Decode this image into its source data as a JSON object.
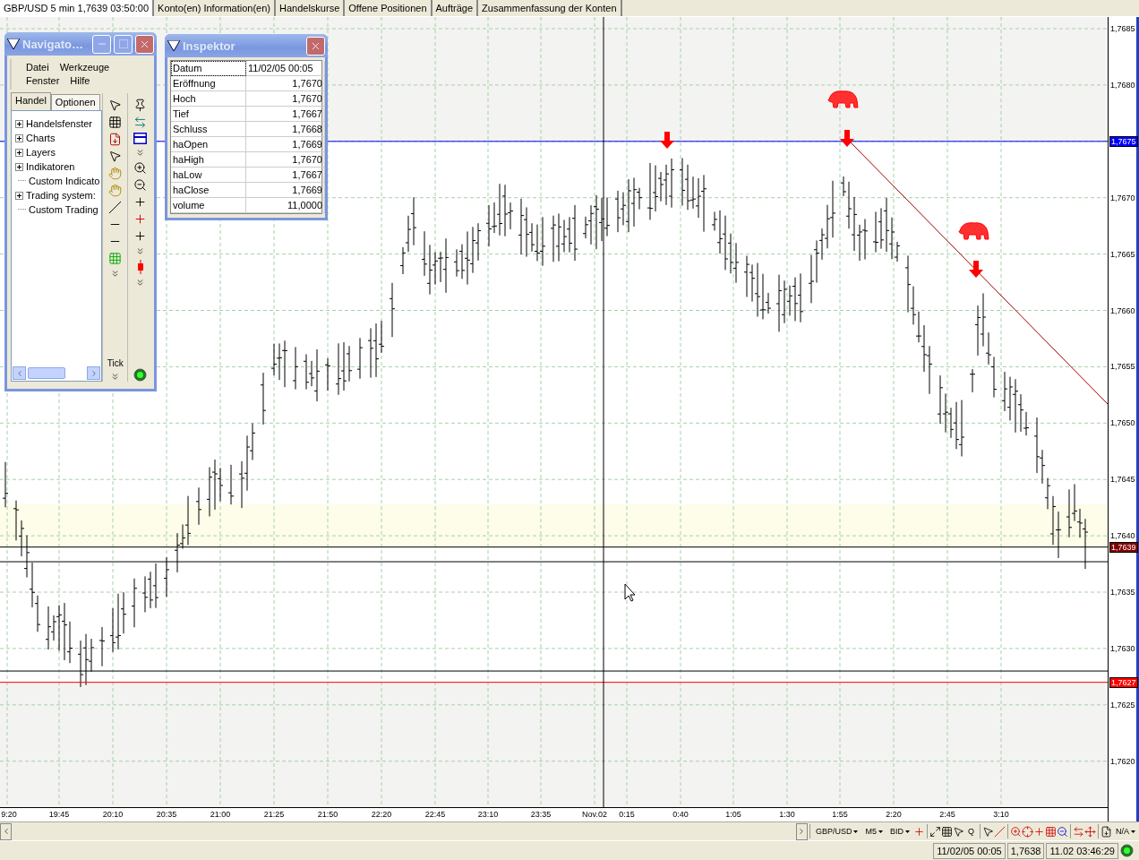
{
  "tabs": [
    {
      "label": "GBP/USD 5 min 1,7639 03:50:00",
      "selected": true
    },
    {
      "label": "Konto(en) Information(en)",
      "selected": false
    },
    {
      "label": "Handelskurse",
      "selected": false
    },
    {
      "label": "Offene Positionen",
      "selected": false
    },
    {
      "label": "Aufträge",
      "selected": false
    },
    {
      "label": "Zusammenfassung der Konten",
      "selected": false
    }
  ],
  "chart": {
    "y_axis_labels": [
      "1,7685",
      "1,7680",
      "1,7670",
      "1,7665",
      "1,7660",
      "1,7655",
      "1,7650",
      "1,7645",
      "1,7640",
      "1,7635",
      "1,7630",
      "1,7625",
      "1,7620"
    ],
    "price_markers": [
      {
        "label": "1,7675",
        "color": "#0000ff"
      },
      {
        "label": "1,7639",
        "color": "#800000"
      },
      {
        "label": "1,7627",
        "color": "#ff0000"
      }
    ],
    "x_axis_labels": [
      "9:20",
      "19:45",
      "20:10",
      "20:35",
      "21:00",
      "21:25",
      "21:50",
      "22:20",
      "22:45",
      "23:10",
      "23:35",
      "Nov.02",
      "0:15",
      "0:40",
      "1:05",
      "1:30",
      "1:55",
      "2:20",
      "2:45",
      "3:10"
    ]
  },
  "navigator": {
    "title": "Navigato…",
    "menu": [
      "Datei",
      "Werkzeuge",
      "Fenster",
      "Hilfe"
    ],
    "tabs": [
      {
        "label": "Handel",
        "selected": true
      },
      {
        "label": "Optionen",
        "selected": false
      }
    ],
    "tree": [
      {
        "label": "Handelsfenster",
        "expandable": true
      },
      {
        "label": "Charts",
        "expandable": true
      },
      {
        "label": "Layers",
        "expandable": true
      },
      {
        "label": "Indikatoren",
        "expandable": true
      },
      {
        "label": "Custom Indicato",
        "expandable": false
      },
      {
        "label": "Trading system:",
        "expandable": true
      },
      {
        "label": "Custom Trading",
        "expandable": false
      }
    ],
    "tool_label": "Tick"
  },
  "inspector": {
    "title": "Inspektor",
    "rows": [
      {
        "label": "Datum",
        "value": "11/02/05 00:05",
        "selected": true
      },
      {
        "label": "Eröffnung",
        "value": "1,7670",
        "selected": false
      },
      {
        "label": "Hoch",
        "value": "1,7670",
        "selected": false
      },
      {
        "label": "Tief",
        "value": "1,7667",
        "selected": false
      },
      {
        "label": "Schluss",
        "value": "1,7668",
        "selected": false
      },
      {
        "label": "haOpen",
        "value": "1,7669",
        "selected": false
      },
      {
        "label": "haHigh",
        "value": "1,7670",
        "selected": false
      },
      {
        "label": "haLow",
        "value": "1,7667",
        "selected": false
      },
      {
        "label": "haClose",
        "value": "1,7669",
        "selected": false
      },
      {
        "label": "volume",
        "value": "11,0000",
        "selected": false
      }
    ]
  },
  "toolbar": {
    "dropdowns": [
      "GBP/USD",
      "M5",
      "BID"
    ],
    "q_label": "Q",
    "na_dropdown": "N/A"
  },
  "status_bar": {
    "datetime": "11/02/05 00:05",
    "price": "1,7638",
    "clock": "11.02 03:46:29"
  }
}
